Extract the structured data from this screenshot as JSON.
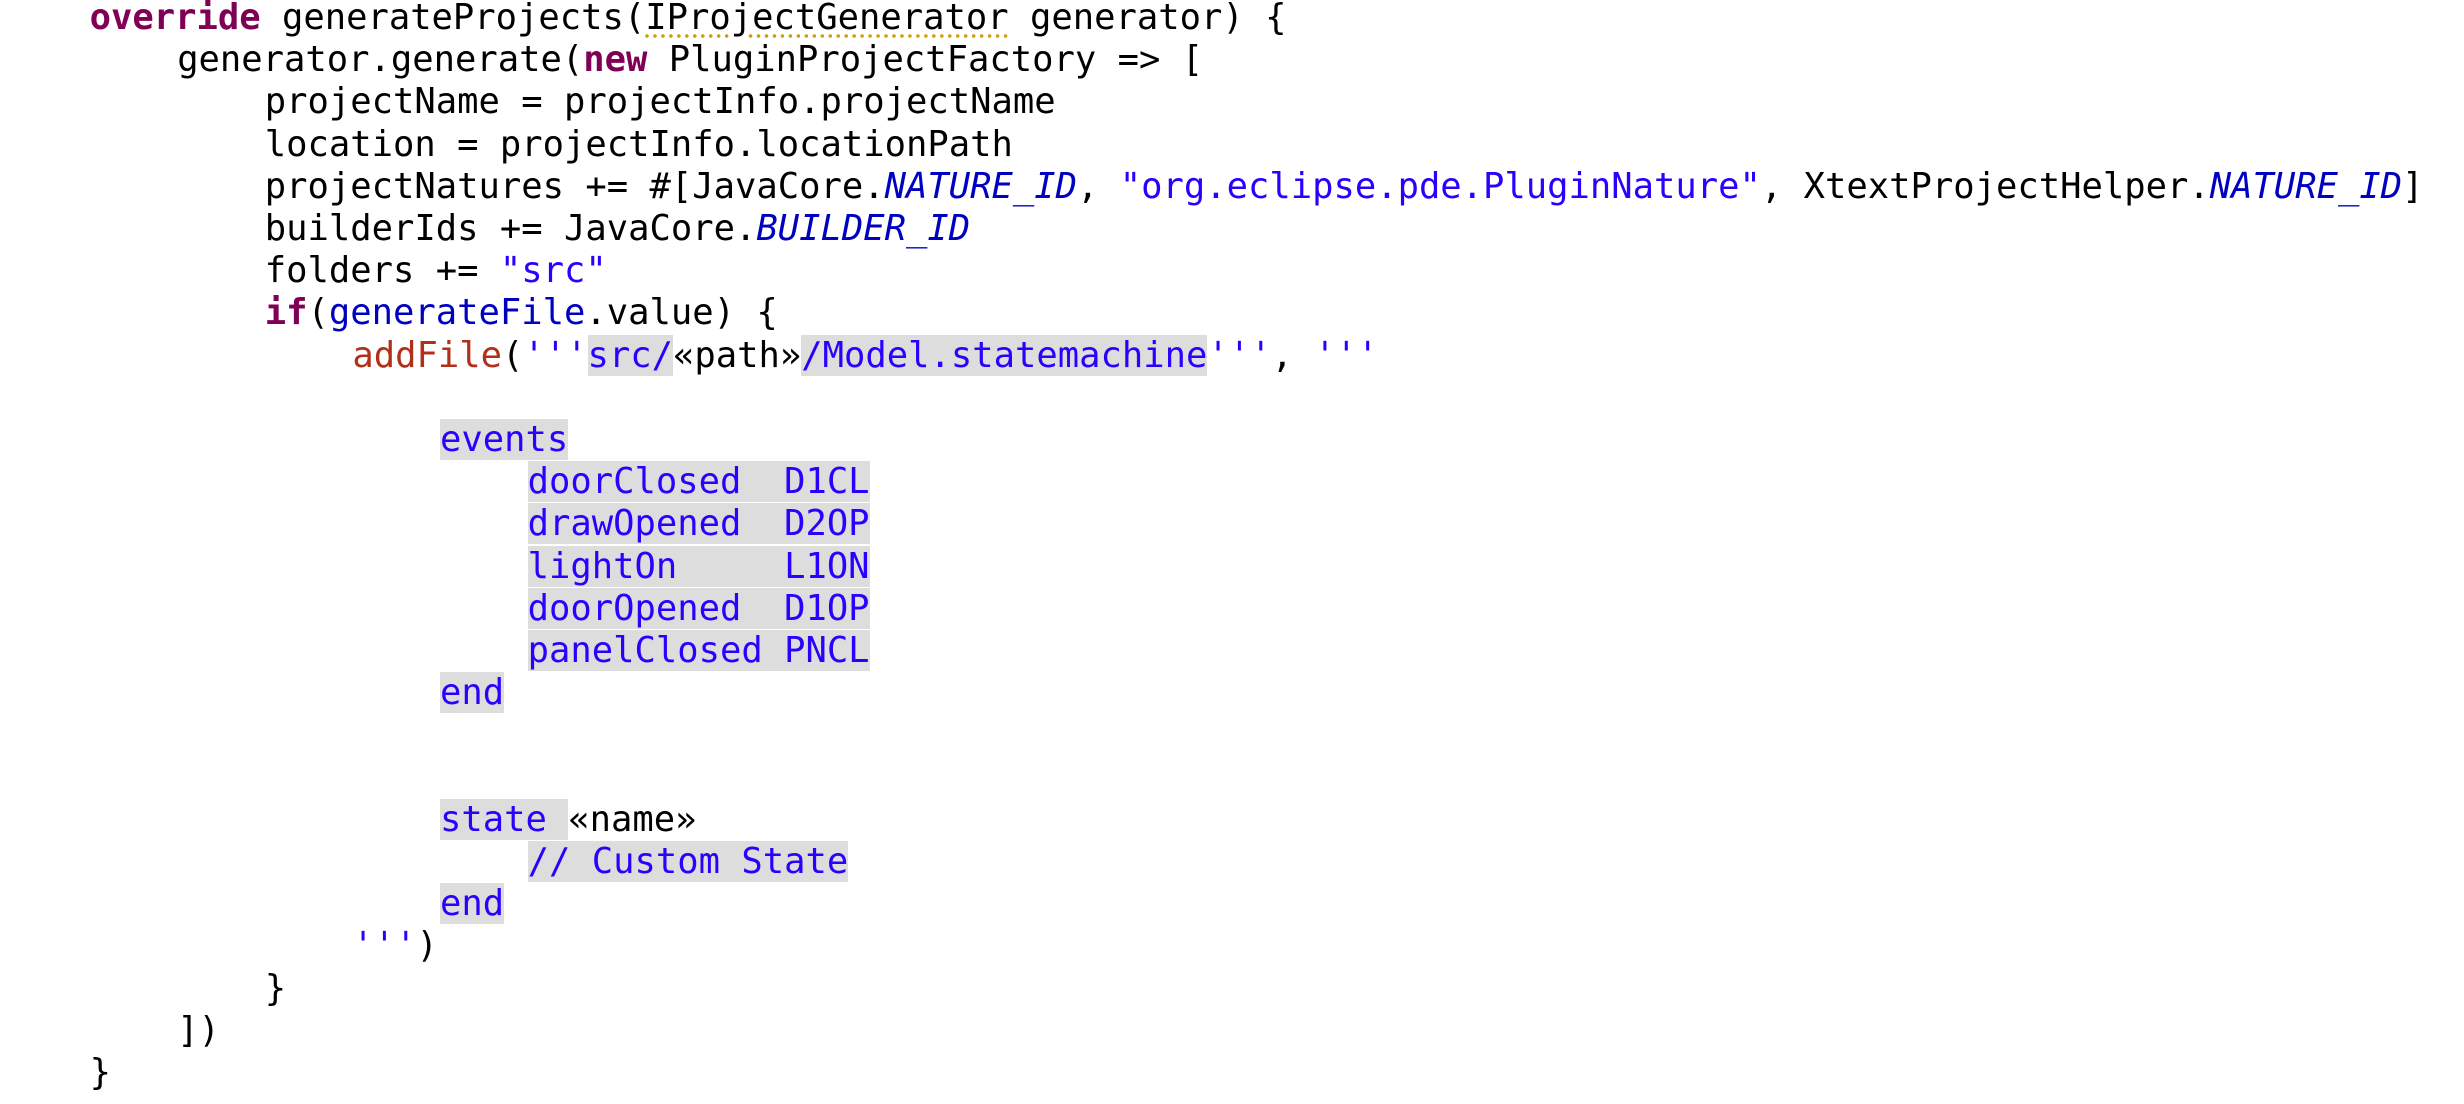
{
  "editor": {
    "lines": [
      {
        "indent": 1,
        "tokens": [
          {
            "t": "override",
            "c": "kw"
          },
          {
            "t": " generateProjects("
          },
          {
            "t": "IProjectGenerator",
            "c": "warn"
          },
          {
            "t": " generator) {"
          }
        ]
      },
      {
        "indent": 2,
        "tokens": [
          {
            "t": "generator.generate("
          },
          {
            "t": "new",
            "c": "kw"
          },
          {
            "t": " PluginProjectFactory => ["
          }
        ]
      },
      {
        "indent": 3,
        "tokens": [
          {
            "t": "projectName = projectInfo.projectName"
          }
        ]
      },
      {
        "indent": 3,
        "tokens": [
          {
            "t": "location = projectInfo.locationPath"
          }
        ]
      },
      {
        "indent": 3,
        "tokens": [
          {
            "t": "projectNatures += #[JavaCore."
          },
          {
            "t": "NATURE_ID",
            "c": "cst"
          },
          {
            "t": ", "
          },
          {
            "t": "\"org.eclipse.pde.PluginNature\"",
            "c": "str"
          },
          {
            "t": ", XtextProjectHelper."
          },
          {
            "t": "NATURE_ID",
            "c": "cst"
          },
          {
            "t": "]"
          }
        ]
      },
      {
        "indent": 3,
        "tokens": [
          {
            "t": "builderIds += JavaCore."
          },
          {
            "t": "BUILDER_ID",
            "c": "cst"
          }
        ]
      },
      {
        "indent": 3,
        "tokens": [
          {
            "t": "folders += "
          },
          {
            "t": "\"src\"",
            "c": "str"
          }
        ]
      },
      {
        "indent": 3,
        "tokens": [
          {
            "t": "if",
            "c": "kw"
          },
          {
            "t": "("
          },
          {
            "t": "generateFile",
            "c": "fld"
          },
          {
            "t": ".value) {"
          }
        ]
      },
      {
        "indent": 4,
        "tokens": [
          {
            "t": "addFile",
            "c": "mth"
          },
          {
            "t": "("
          },
          {
            "t": "'''",
            "c": "tpl-end"
          },
          {
            "t": "src/",
            "c": "tpl"
          },
          {
            "t": "«path»",
            "c": "gui"
          },
          {
            "t": "/Model.statemachine",
            "c": "tpl"
          },
          {
            "t": "'''",
            "c": "tpl-end"
          },
          {
            "t": ", "
          },
          {
            "t": "'''",
            "c": "tpl-end"
          }
        ]
      },
      {
        "indent": 0,
        "tokens": []
      },
      {
        "indent": 5,
        "tokens": [
          {
            "t": "events",
            "c": "tpl"
          }
        ]
      },
      {
        "indent": 6,
        "tokens": [
          {
            "t": "doorClosed  D1CL",
            "c": "tpl"
          }
        ]
      },
      {
        "indent": 6,
        "tokens": [
          {
            "t": "drawOpened  D2OP",
            "c": "tpl"
          }
        ]
      },
      {
        "indent": 6,
        "tokens": [
          {
            "t": "lightOn     L1ON",
            "c": "tpl"
          }
        ]
      },
      {
        "indent": 6,
        "tokens": [
          {
            "t": "doorOpened  D1OP",
            "c": "tpl"
          }
        ]
      },
      {
        "indent": 6,
        "tokens": [
          {
            "t": "panelClosed PNCL",
            "c": "tpl"
          }
        ]
      },
      {
        "indent": 5,
        "tokens": [
          {
            "t": "end",
            "c": "tpl"
          }
        ]
      },
      {
        "indent": 0,
        "tokens": []
      },
      {
        "indent": 0,
        "tokens": []
      },
      {
        "indent": 5,
        "tokens": [
          {
            "t": "state ",
            "c": "tpl"
          },
          {
            "t": "«name»",
            "c": "gui"
          }
        ]
      },
      {
        "indent": 6,
        "tokens": [
          {
            "t": "// Custom State",
            "c": "tpl"
          }
        ]
      },
      {
        "indent": 5,
        "tokens": [
          {
            "t": "end",
            "c": "tpl"
          }
        ]
      },
      {
        "indent": 4,
        "tokens": [
          {
            "t": "'''",
            "c": "tpl-end"
          },
          {
            "t": ")"
          }
        ]
      },
      {
        "indent": 3,
        "tokens": [
          {
            "t": "}"
          }
        ]
      },
      {
        "indent": 2,
        "tokens": [
          {
            "t": "])"
          }
        ]
      },
      {
        "indent": 1,
        "tokens": [
          {
            "t": "}"
          }
        ]
      }
    ]
  }
}
